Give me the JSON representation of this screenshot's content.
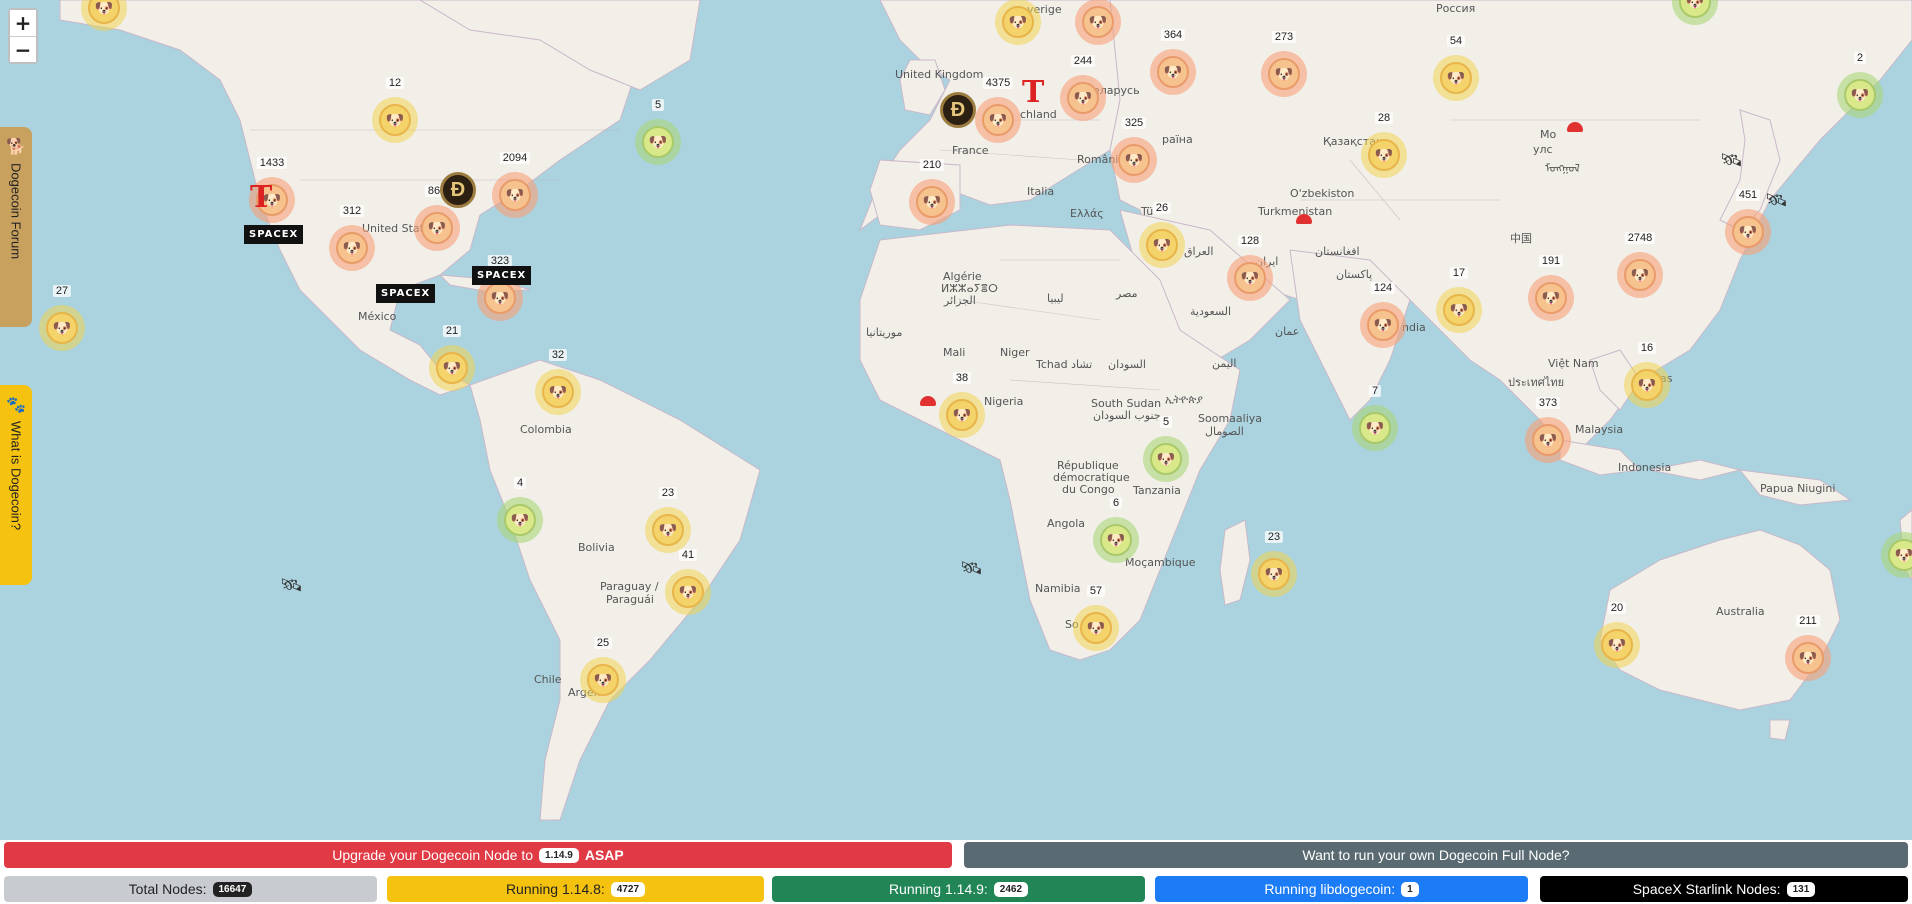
{
  "zoom": {
    "in_label": "+",
    "out_label": "−"
  },
  "side_tabs": {
    "forum_label": "Dogecoin Forum",
    "what_label": "What is Dogecoin?"
  },
  "places": {
    "united_kingdom": "United Kingdom",
    "russia": "Россия",
    "belarus": "еларусь",
    "ukraine": "раїна",
    "romania": "România",
    "france": "France",
    "deutschland": "chland",
    "italia": "Italia",
    "ellas": "Ελλάς",
    "tu": "Tü",
    "kazakhstan": "Қазақстан",
    "ozbekiston": "O'zbekiston",
    "turkmenistan": "Turkmenistan",
    "iraq": "العراق",
    "iran": "ایران",
    "afghanistan": "افغانستان",
    "pakistan": "پاکستان",
    "saudi": "السعودية",
    "yemen": "اليمن",
    "oman": "عمان",
    "misr": "مصر",
    "libya": "ليبيا",
    "algerie": "Algérie",
    "algerie_tifinagh": "ⵍⵣⵣⴰⵢⴻⵔ",
    "algerie_ar": "الجزائر",
    "mauritania": "موريتانيا",
    "mali": "Mali",
    "niger": "Niger",
    "tchad": "Tchad تشاد",
    "sudan": "السودان",
    "nigeria": "Nigeria",
    "south_sudan": "South Sudan",
    "south_sudan_ar": "جنوب السودان",
    "ethiopia": "ኢትዮጵያ",
    "somalia": "Soomaaliya",
    "somalia_ar": "الصومال",
    "drc1": "République",
    "drc2": "démocratique",
    "drc3": "du Congo",
    "tanzania": "Tanzania",
    "angola": "Angola",
    "mocambique": "Moçambique",
    "namibia": "Namibia",
    "south_africa": "So",
    "india": "ndia",
    "china": "中国",
    "mongolia": "Мо",
    "mongolia2": "улс",
    "mongolia3": "ᠮᠣᠩᠭᠣᠯ",
    "vietnam": "Việt Nam",
    "thailand": "ประเทศไทย",
    "malaysia": "Malaysia",
    "indonesia": "Indonesia",
    "papua": "Papua Niugini",
    "australia": "Australia",
    "pilipinas": "as",
    "united_states": "United States",
    "mexico": "México",
    "colombia": "Colombia",
    "bolivia": "Bolivia",
    "paraguay1": "Paraguay /",
    "paraguay2": "Paraguái",
    "chile": "Chile",
    "argentina": "Argen",
    "sverige": "verige"
  },
  "clusters": [
    {
      "count": "",
      "color": "yellow",
      "kind": "cluster"
    },
    {
      "count": "12",
      "color": "yellow"
    },
    {
      "count": "5",
      "color": "green"
    },
    {
      "count": "1433",
      "color": "orange"
    },
    {
      "count": "2094",
      "color": "orange"
    },
    {
      "count": "869",
      "color": "orange"
    },
    {
      "count": "312",
      "color": "orange"
    },
    {
      "count": "323",
      "color": "orange"
    },
    {
      "count": "27",
      "color": "yellow"
    },
    {
      "count": "21",
      "color": "yellow"
    },
    {
      "count": "32",
      "color": "yellow"
    },
    {
      "count": "4",
      "color": "green"
    },
    {
      "count": "23",
      "color": "yellow"
    },
    {
      "count": "41",
      "color": "yellow"
    },
    {
      "count": "25",
      "color": "yellow"
    },
    {
      "count": "",
      "color": "yellow"
    },
    {
      "count": "",
      "color": "orange"
    },
    {
      "count": "244",
      "color": "orange"
    },
    {
      "count": "4375",
      "color": "orange"
    },
    {
      "count": "364",
      "color": "orange"
    },
    {
      "count": "273",
      "color": "orange"
    },
    {
      "count": "54",
      "color": "yellow"
    },
    {
      "count": "",
      "color": "green"
    },
    {
      "count": "2",
      "color": "green"
    },
    {
      "count": "325",
      "color": "orange"
    },
    {
      "count": "28",
      "color": "yellow"
    },
    {
      "count": "210",
      "color": "orange"
    },
    {
      "count": "26",
      "color": "yellow"
    },
    {
      "count": "128",
      "color": "orange"
    },
    {
      "count": "124",
      "color": "orange"
    },
    {
      "count": "17",
      "color": "yellow"
    },
    {
      "count": "191",
      "color": "orange"
    },
    {
      "count": "2748",
      "color": "orange"
    },
    {
      "count": "451",
      "color": "orange"
    },
    {
      "count": "38",
      "color": "yellow"
    },
    {
      "count": "7",
      "color": "green"
    },
    {
      "count": "16",
      "color": "yellow"
    },
    {
      "count": "373",
      "color": "orange"
    },
    {
      "count": "5",
      "color": "green"
    },
    {
      "count": "6",
      "color": "green"
    },
    {
      "count": "23",
      "color": "yellow"
    },
    {
      "count": "57",
      "color": "yellow"
    },
    {
      "count": "20",
      "color": "yellow"
    },
    {
      "count": "211",
      "color": "orange"
    },
    {
      "count": "",
      "color": "green"
    }
  ],
  "spacex_label": "SPACEX",
  "tesla_label": "T",
  "coin_label": "Đ",
  "bottom": {
    "upgrade_prefix": "Upgrade your Dogecoin Node to",
    "upgrade_version": "1.14.9",
    "upgrade_suffix": "ASAP",
    "own_node": "Want to run your own Dogecoin Full Node?",
    "total_label": "Total Nodes:",
    "total_value": "16647",
    "v1148_label": "Running 1.14.8:",
    "v1148_value": "4727",
    "v1149_label": "Running 1.14.9:",
    "v1149_value": "2462",
    "lib_label": "Running libdogecoin:",
    "lib_value": "1",
    "starlink_label": "SpaceX Starlink Nodes:",
    "starlink_value": "131"
  },
  "colors": {
    "ocean": "#aad3df",
    "land": "#f2efe9",
    "upgrade": "#e03a45",
    "own_node": "#5a6a72",
    "v1148": "#f5c20f",
    "v1149": "#218555",
    "lib": "#1c7cf5",
    "starlink": "#000000"
  }
}
